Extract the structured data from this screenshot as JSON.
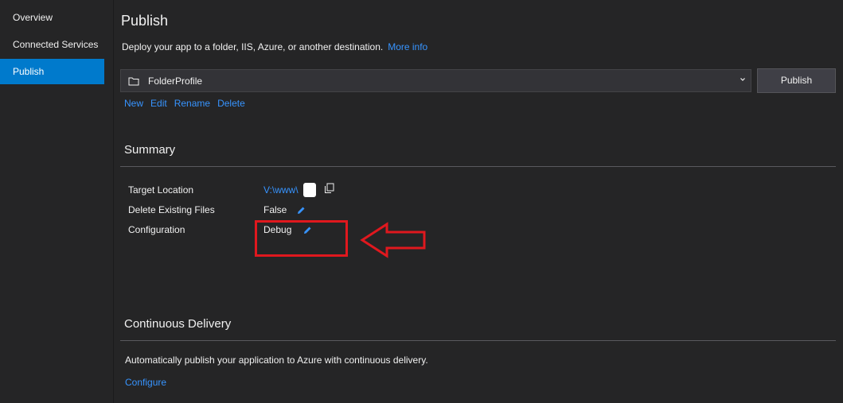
{
  "sidebar": {
    "items": [
      {
        "label": "Overview"
      },
      {
        "label": "Connected Services"
      },
      {
        "label": "Publish"
      }
    ]
  },
  "header": {
    "title": "Publish",
    "description": "Deploy your app to a folder, IIS, Azure, or another destination.",
    "more_info": "More info"
  },
  "profile": {
    "selected": "FolderProfile",
    "icon": "folder-icon",
    "publish_label": "Publish",
    "actions": [
      "New",
      "Edit",
      "Rename",
      "Delete"
    ]
  },
  "summary": {
    "title": "Summary",
    "rows": [
      {
        "label": "Target Location",
        "value": "V:\\www\\",
        "icon": "copy-icon"
      },
      {
        "label": "Delete Existing Files",
        "value": "False",
        "icon": "pencil-icon"
      },
      {
        "label": "Configuration",
        "value": "Debug",
        "icon": "pencil-icon"
      }
    ]
  },
  "continuous_delivery": {
    "title": "Continuous Delivery",
    "description": "Automatically publish your application to Azure with continuous delivery.",
    "configure_label": "Configure"
  },
  "colors": {
    "accent": "#007acc",
    "link": "#3794ff",
    "annotation": "#e0181e",
    "background": "#252526"
  }
}
